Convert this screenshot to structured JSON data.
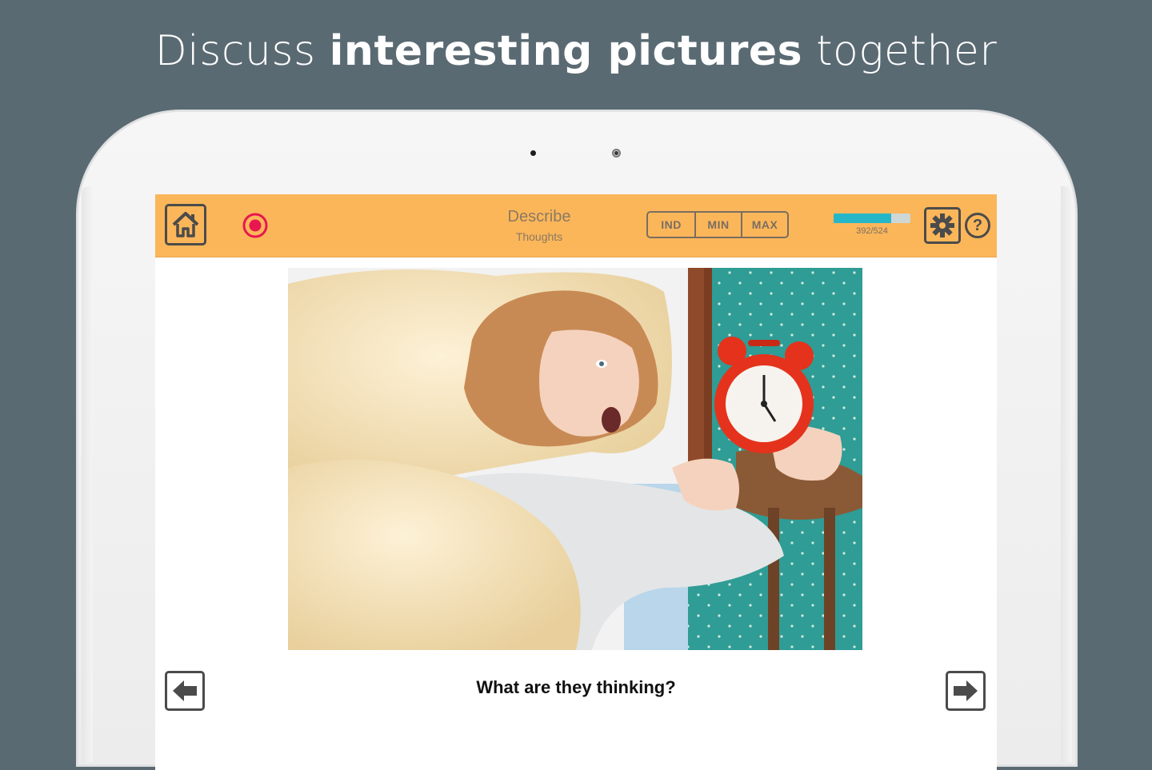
{
  "headline": {
    "pre": "Discuss ",
    "strong": "interesting pictures",
    "post": " together"
  },
  "toolbar": {
    "mode_title": "Describe",
    "mode_subtitle": "Thoughts",
    "segments": [
      "IND",
      "MIN",
      "MAX"
    ],
    "progress_label": "392/524",
    "progress_fraction": 0.75,
    "help_label": "?"
  },
  "content": {
    "prompt": "What are they thinking?"
  },
  "colors": {
    "toolbar_bg": "#fbb65a",
    "progress_fill": "#25b6c7",
    "record_red": "#e8174f",
    "icon_dark": "#4b4b4b"
  },
  "icons": [
    "home-icon",
    "record-icon",
    "gear-icon",
    "help-icon",
    "arrow-left-icon",
    "arrow-right-icon"
  ]
}
